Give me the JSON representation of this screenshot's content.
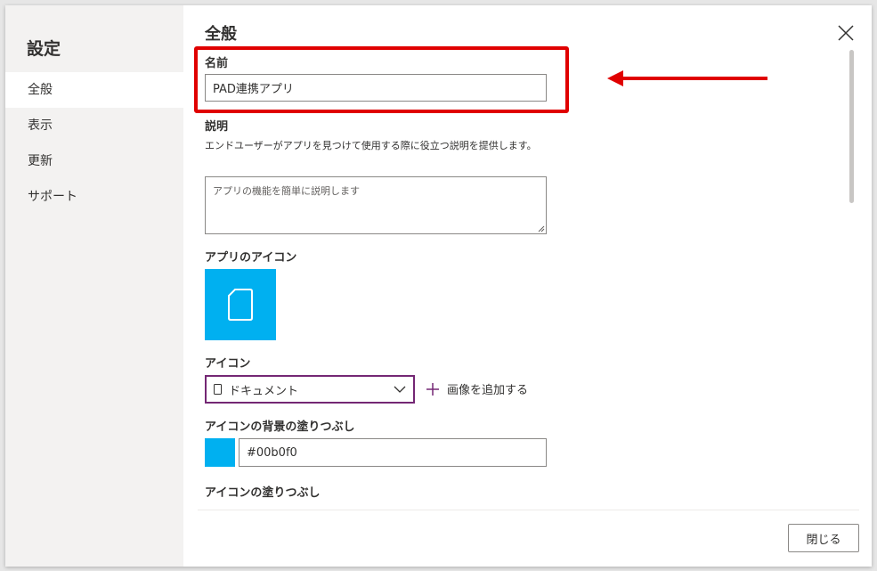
{
  "sidebar": {
    "title": "設定",
    "items": [
      {
        "label": "全般",
        "active": true
      },
      {
        "label": "表示",
        "active": false
      },
      {
        "label": "更新",
        "active": false
      },
      {
        "label": "サポート",
        "active": false
      }
    ]
  },
  "main": {
    "title": "全般",
    "name_label": "名前",
    "name_value": "PAD連携アプリ",
    "description_label": "説明",
    "description_help": "エンドユーザーがアプリを見つけて使用する際に役立つ説明を提供します。",
    "description_placeholder": "アプリの機能を簡単に説明します",
    "app_icon_label": "アプリのアイコン",
    "icon_label": "アイコン",
    "icon_value": "ドキュメント",
    "icon_value_icon": "document-icon",
    "add_image_label": "画像を追加する",
    "bg_fill_label": "アイコンの背景の塗りつぶし",
    "bg_fill_value": "#00b0f0",
    "icon_fill_label": "アイコンの塗りつぶし"
  },
  "footer": {
    "close_label": "閉じる"
  },
  "colors": {
    "accent_purple": "#742774",
    "icon_background": "#00b0f0",
    "annotation_red": "#e00000"
  }
}
